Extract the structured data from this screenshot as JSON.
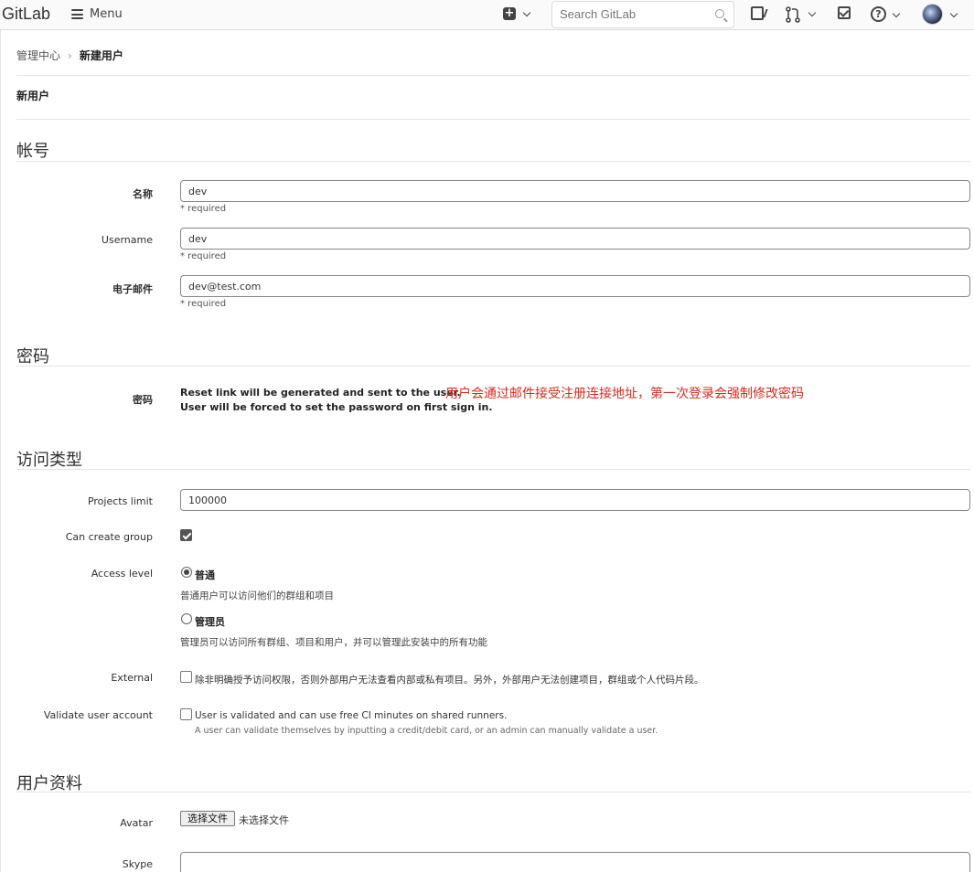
{
  "navbar": {
    "brand": "GitLab",
    "menu_label": "Menu",
    "search_placeholder": "Search GitLab",
    "help_glyph": "?",
    "plus_glyph": "+"
  },
  "breadcrumb": {
    "parent": "管理中心",
    "separator": "›",
    "current": "新建用户"
  },
  "page_title": "新用户",
  "sections": {
    "account": "帐号",
    "password": "密码",
    "access": "访问类型",
    "profile": "用户资料"
  },
  "account": {
    "name_label": "名称",
    "name_value": "dev",
    "username_label": "Username",
    "username_value": "dev",
    "email_label": "电子邮件",
    "email_value": "dev@test.com",
    "required_hint": "* required"
  },
  "password": {
    "label": "密码",
    "line1": "Reset link will be generated and sent to the user.",
    "line2": "User will be forced to set the password on first sign in.",
    "annotation": "用户会通过邮件接受注册连接地址，第一次登录会强制修改密码"
  },
  "access": {
    "projects_limit_label": "Projects limit",
    "projects_limit_value": "100000",
    "can_create_group_label": "Can create group",
    "can_create_group_checked": true,
    "access_level_label": "Access level",
    "options": [
      {
        "label": "普通",
        "help": "普通用户可以访问他们的群组和项目",
        "selected": true
      },
      {
        "label": "管理员",
        "help": "管理员可以访问所有群组、项目和用户，并可以管理此安装中的所有功能",
        "selected": false
      }
    ],
    "external_label": "External",
    "external_text": "除非明确授予访问权限，否则外部用户无法查看内部或私有项目。另外，外部用户无法创建项目，群组或个人代码片段。",
    "validate_label": "Validate user account",
    "validate_text": "User is validated and can use free CI minutes on shared runners.",
    "validate_help": "A user can validate themselves by inputting a credit/debit card, or an admin can manually validate a user."
  },
  "profile": {
    "avatar_label": "Avatar",
    "file_button": "选择文件",
    "file_none": "未选择文件",
    "skype_label": "Skype",
    "skype_value": ""
  },
  "colors": {
    "annotation": "#e0281e",
    "navbar_bg": "#fafafa"
  }
}
